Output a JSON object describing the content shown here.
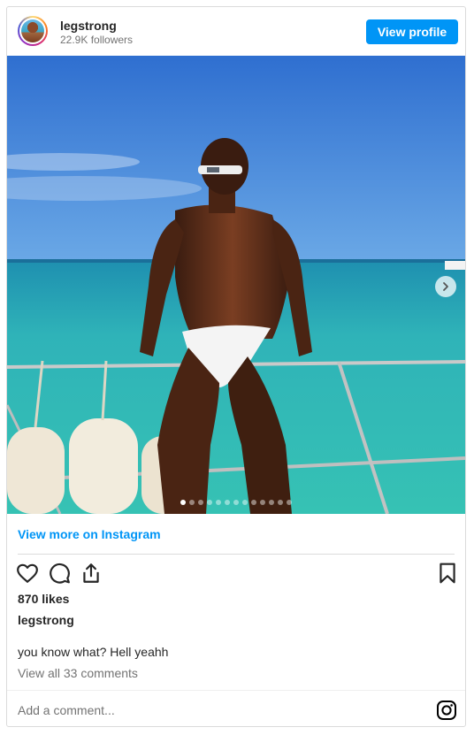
{
  "header": {
    "username": "legstrong",
    "followers": "22.9K followers",
    "view_profile_label": "View profile"
  },
  "carousel": {
    "slide_count": 13,
    "active_index": 0
  },
  "footer": {
    "view_more_label": "View more on Instagram",
    "likes": "870 likes",
    "caption_username": "legstrong",
    "caption": "you know what? Hell yeahh",
    "view_comments": "View all 33 comments",
    "add_comment_placeholder": "Add a comment..."
  },
  "icons": [
    "heart-icon",
    "comment-icon",
    "share-icon",
    "bookmark-icon",
    "instagram-icon",
    "chevron-right-icon"
  ],
  "colors": {
    "accent": "#0095f6",
    "text": "#262626",
    "muted": "#737373",
    "border": "#dbdbdb"
  }
}
